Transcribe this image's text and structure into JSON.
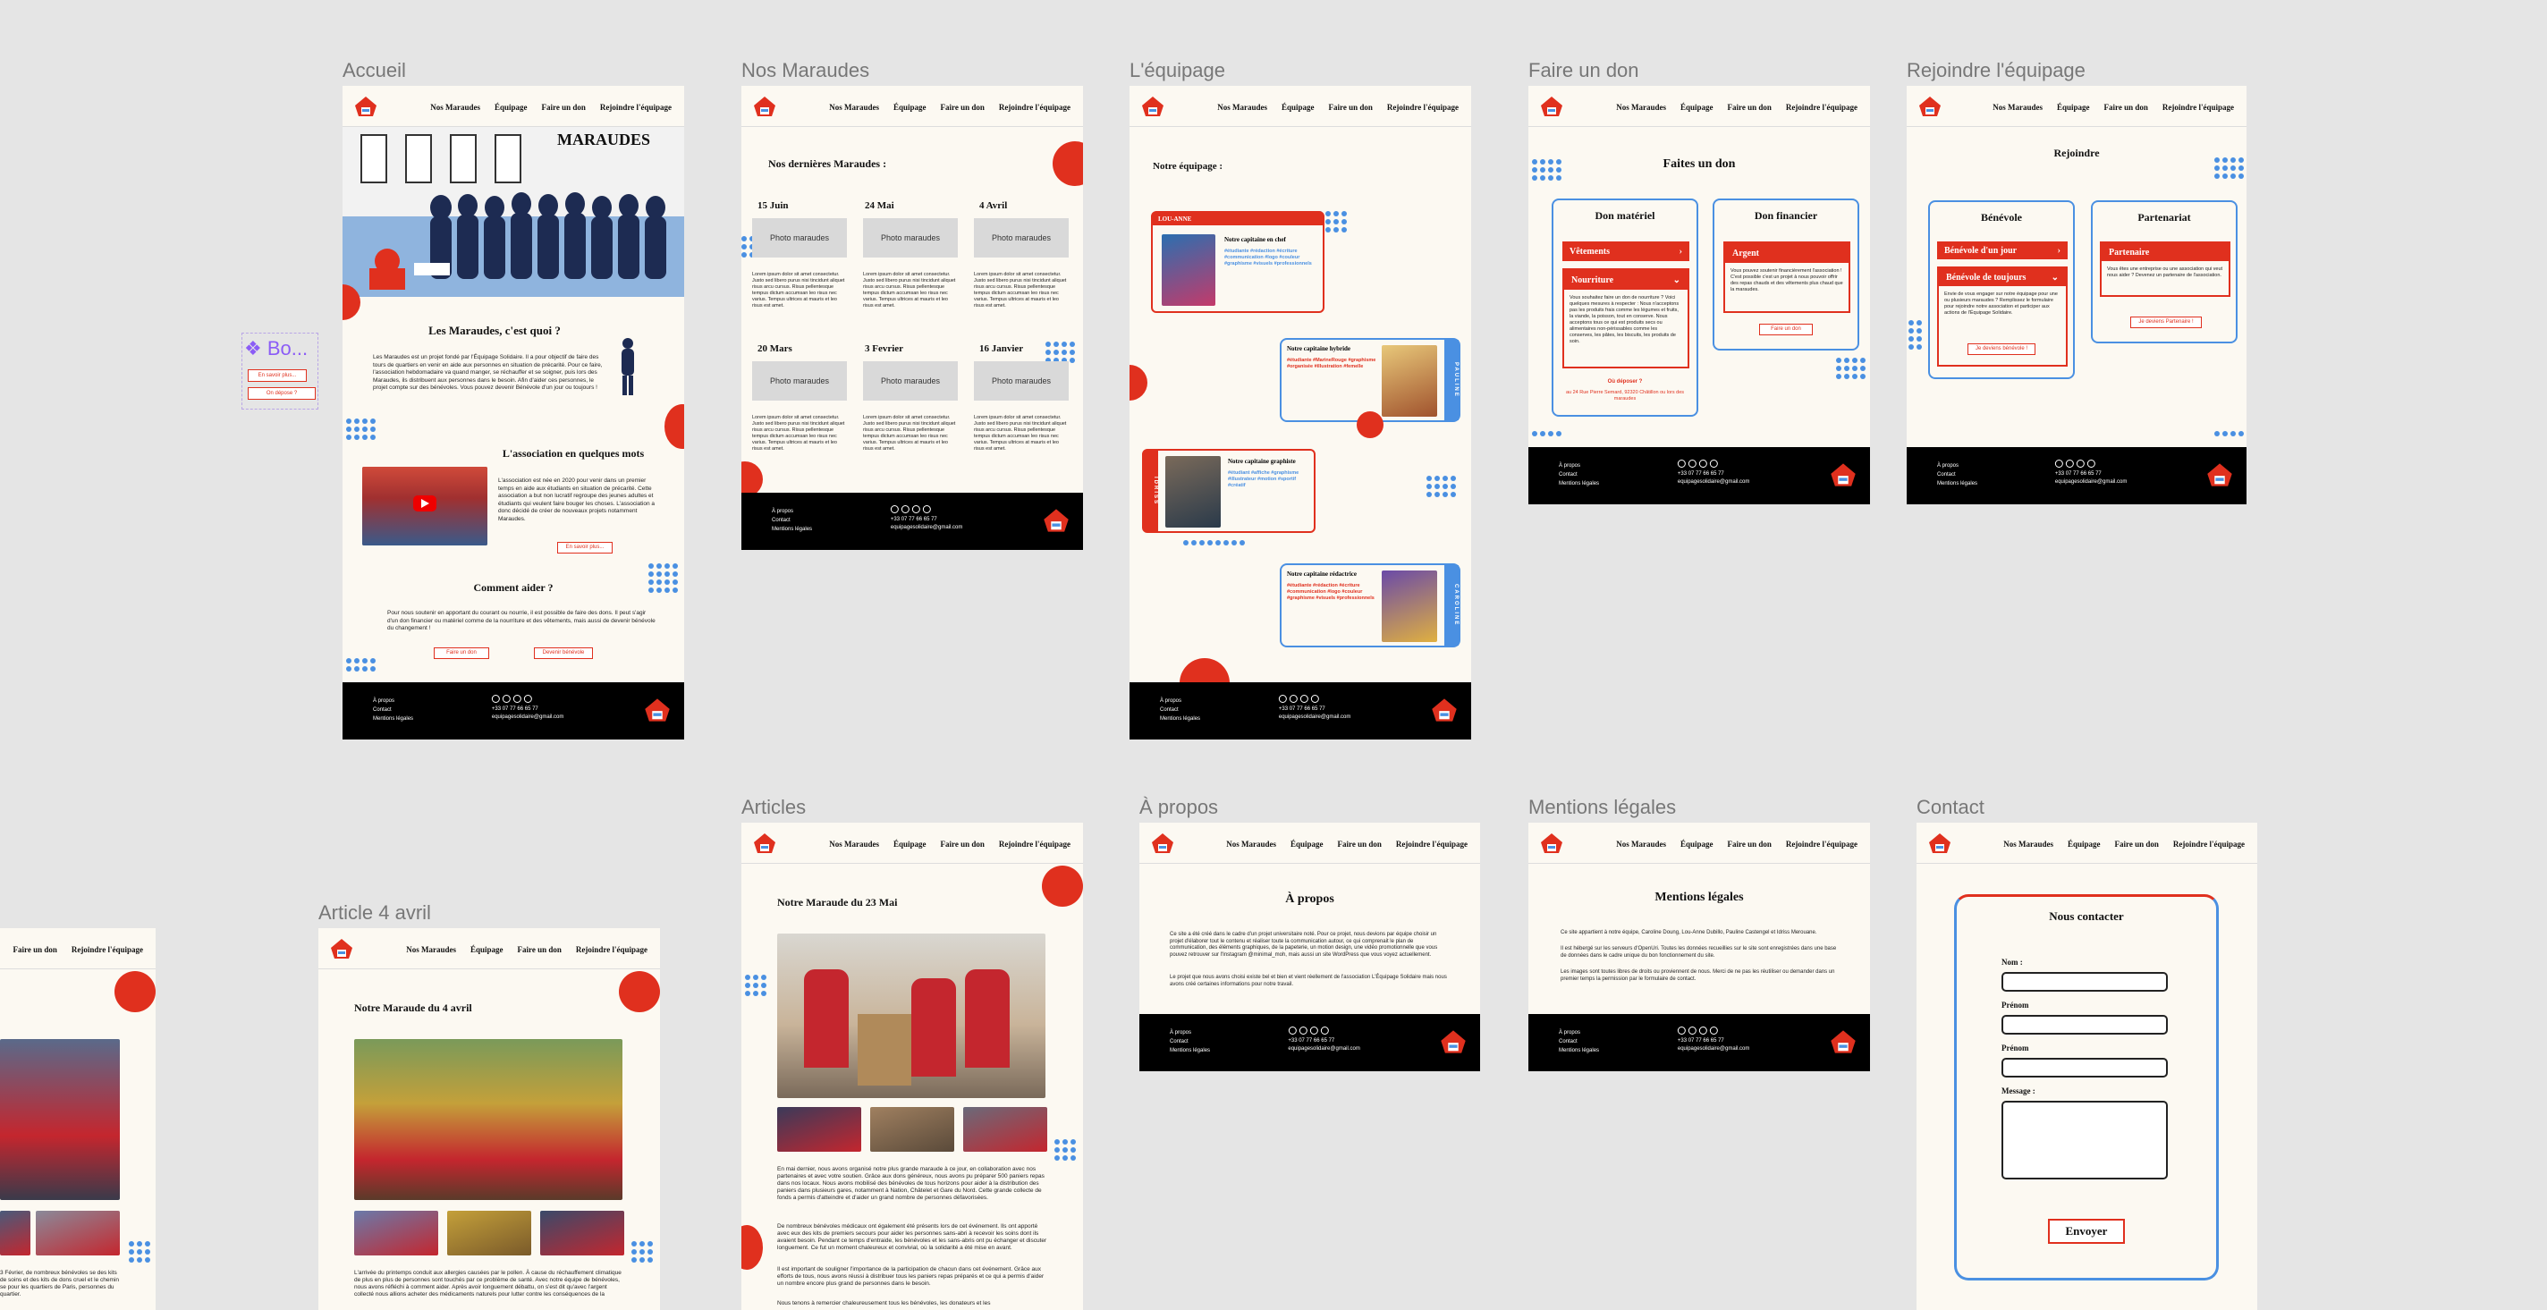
{
  "canvas": {
    "background": "#e5e5e5"
  },
  "colors": {
    "accent_red": "#e0301e",
    "accent_blue": "#4a90e2",
    "cream": "#fcf9f2",
    "footer_black": "#000000"
  },
  "frames": {
    "accueil": "Accueil",
    "nos_maraudes": "Nos Maraudes",
    "equipage": "L'équipage",
    "faire_un_don": "Faire un don",
    "rejoindre": "Rejoindre l'équipage",
    "articles": "Articles",
    "a_propos": "À propos",
    "mentions": "Mentions légales",
    "contact": "Contact",
    "article4": "Article 4 avril"
  },
  "nav": {
    "items": [
      "Nos Maraudes",
      "Équipage",
      "Faire un don",
      "Rejoindre l'équipage"
    ]
  },
  "footer": {
    "links": [
      "À propos",
      "Contact",
      "Mentions légales"
    ],
    "phone": "+33 07 77 66 65 77",
    "email": "equipagesolidaire@gmail.com"
  },
  "component": {
    "name": "Bo...",
    "btn1": "En savoir plus...",
    "btn2": "On dépose ?"
  },
  "accueil": {
    "hero_title": "MARAUDES",
    "q_title": "Les Maraudes, c'est quoi ?",
    "q_text": "Les Maraudes est un projet fondé par l'Équipage Solidaire. Il a pour objectif de faire des tours de quartiers en venir en aide aux personnes en situation de précarité. Pour ce faire, l'association hebdomadaire va quand manger, se réchauffer et se soigner, puis lors des Maraudes, ils distribuent aux personnes dans le besoin. Afin d'aider ces personnes, le projet compte sur des bénévoles. Vous pouvez devenir Bénévole d'un jour ou toujours !",
    "asso_title": "L'association en quelques mots",
    "asso_text": "L'association est née en 2020 pour venir dans un premier temps en aide aux étudiants en situation de précarité. Cette association a but non lucratif regroupe des jeunes adultes et étudiants qui veulent faire bouger les choses. L'association a donc décidé de créer de nouveaux projets notamment Maraudes.",
    "asso_btn": "En savoir plus...",
    "help_title": "Comment aider ?",
    "help_text": "Pour nous soutenir en apportant du courant ou nourrie, il est possible de faire des dons. Il peut s'agir d'un don financier ou matériel comme de la nourriture et des vêtements, mais aussi de devenir bénévole du changement !",
    "help_btn1": "Faire un don",
    "help_btn2": "Devenir bénévole"
  },
  "maraudes": {
    "title": "Nos dernières Maraudes :",
    "photo_label": "Photo maraudes",
    "dates": [
      "15 Juin",
      "24 Mai",
      "4 Avril",
      "20 Mars",
      "3 Fevrier",
      "16 Janvier"
    ],
    "text": "Lorem ipsum dolor sit amet consectetur. Justo sed libero purus nisi tincidunt aliquet risus arcu cursus. Risus pellentesque tempus dictum accumsan leo risus nec varius. Tempus ultrices at mauris et leo risus est amet."
  },
  "equipage": {
    "title": "Notre équipage :",
    "cards": [
      {
        "name": "LOU-ANNE",
        "role": "Notre capitaine en chef",
        "tags": "#étudiante #rédaction #écriture #communication #logo #couleur #graphisme #visuels #professionnels"
      },
      {
        "name": "PAULINE",
        "role": "Notre capitaine hybride",
        "tags": "#étudiante #MarineRouge #graphisme #organisée #illustration #femelle"
      },
      {
        "name": "IDRISS",
        "role": "Notre capitaine graphiste",
        "tags": "#étudiant #affiche #graphisme #illustrateur #motion #sportif #créatif"
      },
      {
        "name": "CAROLINE",
        "role": "Notre capitaine rédactrice",
        "tags": "#étudiante #rédaction #écriture #communication #logo #couleur #graphisme #visuels #professionnels"
      }
    ]
  },
  "don": {
    "title": "Faites un don",
    "col1": "Don matériel",
    "col2": "Don financier",
    "bar1": "Vêtements",
    "bar2": "Nourriture",
    "bar3": "Argent",
    "text1": "Vous souhaitez faire un don de nourriture ? Voici quelques mesures à respecter : Nous n'acceptons pas les produits frais comme les légumes et fruits, la viande, la poisson, tout en conserve. Nous acceptons tous ce qui est produits secs ou alimentaires non-périssables comme les conserves, les pâtes, les biscuits, les produits de soin.",
    "text2": "Vous pouvez soutenir financièrement l'association ! C'est possible c'est un projet à nous pouvoir offrir des repas chauds et des vêtements plus chaud que la maraudes.",
    "link1": "Où déposer ?",
    "addr": "au 24 Rue Pierre Semard, 92320 Châtillon ou lors des maraudes",
    "btn2": "Faire un don"
  },
  "rejoindre": {
    "title": "Rejoindre",
    "col1": "Bénévole",
    "col2": "Partenariat",
    "bar1": "Bénévole d'un jour",
    "bar2": "Bénévole de toujours",
    "bar3": "Partenaire",
    "text1": "Envie de vous engager sur notre équipage pour une ou plusieurs maraudes ? Remplissez le formulaire pour rejoindre notre association et participer aux actions de l'Équipage Solidaire.",
    "text2": "Vous êtes une entreprise ou une association qui veut nous aider ? Devenez un partenaire de l'association.",
    "btn1": "Je deviens bénévole !",
    "btn2": "Je deviens Partenaire !"
  },
  "articles": {
    "title": "Notre Maraude du 23 Mai",
    "p1": "En mai dernier, nous avons organisé notre plus grande maraude à ce jour, en collaboration avec nos partenaires et avec votre soutien. Grâce aux dons généreux, nous avons pu préparer 500 paniers repas dans nos locaux. Nous avons mobilisé des bénévoles de tous horizons pour aider à la distribution des paniers dans plusieurs gares, notamment à Nation, Châtelet et Gare du Nord. Cette grande collecte de fonds a permis d'atteindre et d'aider un grand nombre de personnes défavorisées.",
    "p2": "De nombreux bénévoles médicaux ont également été présents lors de cet événement. Ils ont apporté avec eux des kits de premiers secours pour aider les personnes sans-abri à recevoir les soins dont ils avaient besoin. Pendant ce temps d'entraide, les bénévoles et les sans-abris ont pu échanger et discuter longuement. Ce fut un moment chaleureux et convivial, où la solidarité a été mise en avant.",
    "p3": "Il est important de souligner l'importance de la participation de chacun dans cet événement. Grâce aux efforts de tous, nous avons réussi à distribuer tous les paniers repas préparés et ce qui a permis d'aider un nombre encore plus grand de personnes dans le besoin.",
    "p4": "Nous tenons à remercier chaleureusement tous les bénévoles, les donateurs et les"
  },
  "apropos": {
    "title": "À propos",
    "p1": "Ce site a été créé dans le cadre d'un projet universitaire noté. Pour ce projet, nous devions par équipe choisir un projet d'élaborer tout le contenu et réaliser toute la communication autour, ce qui comprenait le plan de communication, des éléments graphiques, de la papeterie, un motion design, une vidéo promotionnelle que vous pouvez retrouver sur l'Instagram @minimal_moh, mais aussi un site WordPress que vous voyez actuellement.",
    "p2": "Le projet que nous avons choisi existe bel et bien et vient réellement de l'association L'Équipage Solidaire mais nous avons créé certaines informations pour notre travail."
  },
  "mentions": {
    "title": "Mentions légales",
    "p1": "Ce site appartient à notre équipe, Caroline Doung, Lou-Anne Dubillo, Pauline Castengel et Idriss Merouane.",
    "p2": "Il est hébergé sur les serveurs d'OpenUri. Toutes les données recueillies sur le site sont enregistrées dans une base de données dans le cadre unique du bon fonctionnement du site.",
    "p3": "Les images sont toutes libres de droits ou proviennent de nous. Merci de ne pas les réutiliser ou demander dans un premier temps la permission par le formulaire de contact."
  },
  "contact": {
    "title": "Nous contacter",
    "fields": [
      "Nom :",
      "Prénom",
      "Prénom",
      "Message :"
    ],
    "submit": "Envoyer"
  },
  "article4": {
    "title": "Notre Maraude du 4 avril",
    "p1": "L'arrivée du printemps conduit aux allergies causées par le pollen. À cause du réchauffement climatique de plus en plus de personnes sont touchés par ce problème de santé. Avec notre équipe de bénévoles, nous avons réfléchi à comment aider. Après avoir longuement débattu, on s'est dit qu'avec l'argent collecté nous allions acheter des médicaments naturels pour lutter contre les conséquences de la",
    "left_text": "3 Février, de nombreux bénévoles se des kits de soins et des kits de dons cruel et le chemin se pour les quartiers de Paris, personnes du quartier."
  }
}
